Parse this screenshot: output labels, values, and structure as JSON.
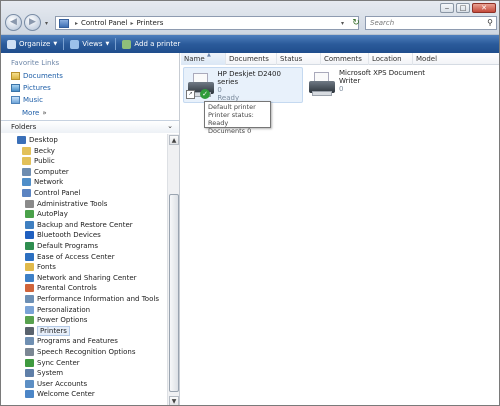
{
  "window": {
    "controls": {
      "minimize": "‒",
      "maximize": "□",
      "close": "✕"
    }
  },
  "address": {
    "crumbs": [
      "Control Panel",
      "Printers"
    ],
    "separator": "▸"
  },
  "search": {
    "placeholder": "Search",
    "icon": "search-icon"
  },
  "toolbar": {
    "items": [
      {
        "label": "Organize",
        "icon": "organize-icon",
        "color": "#cfe0f5"
      },
      {
        "label": "Views",
        "icon": "views-icon",
        "color": "#9bc0ea"
      },
      {
        "label": "Add a printer",
        "icon": "add-printer-icon",
        "color": "#8fc07a"
      }
    ]
  },
  "navpane": {
    "favorite_links_title": "Favorite Links",
    "favorites": [
      {
        "label": "Documents",
        "icon": "documents-icon"
      },
      {
        "label": "Pictures",
        "icon": "pictures-icon"
      },
      {
        "label": "Music",
        "icon": "music-icon"
      }
    ],
    "more_label": "More",
    "more_chevron": "»",
    "folders_label": "Folders",
    "folders_chevron": "⌄",
    "tree": [
      {
        "label": "Desktop",
        "icon": "desktop-icon",
        "color": "#3a6fb8",
        "indent": 0
      },
      {
        "label": "Becky",
        "icon": "user-folder-icon",
        "color": "#e2c059",
        "indent": 1
      },
      {
        "label": "Public",
        "icon": "public-folder-icon",
        "color": "#e2c059",
        "indent": 1
      },
      {
        "label": "Computer",
        "icon": "computer-icon",
        "color": "#6d8cb0",
        "indent": 1
      },
      {
        "label": "Network",
        "icon": "network-icon",
        "color": "#4f8ec9",
        "indent": 1
      },
      {
        "label": "Control Panel",
        "icon": "control-panel-icon",
        "color": "#5b84c2",
        "indent": 1
      },
      {
        "label": "Administrative Tools",
        "icon": "administrative-tools-icon",
        "color": "#8a8a8a",
        "indent": 2
      },
      {
        "label": "AutoPlay",
        "icon": "autoplay-icon",
        "color": "#4aa14a",
        "indent": 2
      },
      {
        "label": "Backup and Restore Center",
        "icon": "backup-icon",
        "color": "#3f7fc0",
        "indent": 2
      },
      {
        "label": "Bluetooth Devices",
        "icon": "bluetooth-icon",
        "color": "#1f5fbf",
        "indent": 2
      },
      {
        "label": "Default Programs",
        "icon": "default-programs-icon",
        "color": "#2e8d4f",
        "indent": 2
      },
      {
        "label": "Ease of Access Center",
        "icon": "ease-of-access-icon",
        "color": "#2c6fc0",
        "indent": 2
      },
      {
        "label": "Fonts",
        "icon": "fonts-icon",
        "color": "#e0b94b",
        "indent": 2
      },
      {
        "label": "Network and Sharing Center",
        "icon": "network-sharing-icon",
        "color": "#3d7fc6",
        "indent": 2
      },
      {
        "label": "Parental Controls",
        "icon": "parental-controls-icon",
        "color": "#d0643a",
        "indent": 2
      },
      {
        "label": "Performance Information and Tools",
        "icon": "performance-icon",
        "color": "#6c8fb4",
        "indent": 2
      },
      {
        "label": "Personalization",
        "icon": "personalization-icon",
        "color": "#7aa3d6",
        "indent": 2
      },
      {
        "label": "Power Options",
        "icon": "power-options-icon",
        "color": "#58a14e",
        "indent": 2
      },
      {
        "label": "Printers",
        "icon": "printers-icon",
        "color": "#59626d",
        "indent": 2,
        "selected": true
      },
      {
        "label": "Programs and Features",
        "icon": "programs-features-icon",
        "color": "#6f8fb2",
        "indent": 2
      },
      {
        "label": "Speech Recognition Options",
        "icon": "speech-recognition-icon",
        "color": "#7b8794",
        "indent": 2
      },
      {
        "label": "Sync Center",
        "icon": "sync-center-icon",
        "color": "#3f9a3f",
        "indent": 2
      },
      {
        "label": "System",
        "icon": "system-icon",
        "color": "#5f7fa8",
        "indent": 2
      },
      {
        "label": "User Accounts",
        "icon": "user-accounts-icon",
        "color": "#5d8fc4",
        "indent": 2
      },
      {
        "label": "Welcome Center",
        "icon": "welcome-center-icon",
        "color": "#4c86c7",
        "indent": 2
      }
    ]
  },
  "content": {
    "columns": [
      {
        "label": "Name",
        "sorted": true
      },
      {
        "label": "Documents"
      },
      {
        "label": "Status"
      },
      {
        "label": "Comments"
      },
      {
        "label": "Location"
      },
      {
        "label": "Model"
      }
    ],
    "sort_arrow": "▲",
    "printers": [
      {
        "name": "HP Deskjet D2400 series",
        "documents": "0",
        "status": "Ready",
        "default": true,
        "check": "✓",
        "shortcut": "↗"
      },
      {
        "name": "Microsoft XPS Document",
        "name2": "Writer",
        "documents": "0",
        "default": false
      }
    ],
    "tooltip": {
      "line1": "Default printer",
      "line2": "Printer status: Ready",
      "line3": "Documents 0"
    }
  }
}
